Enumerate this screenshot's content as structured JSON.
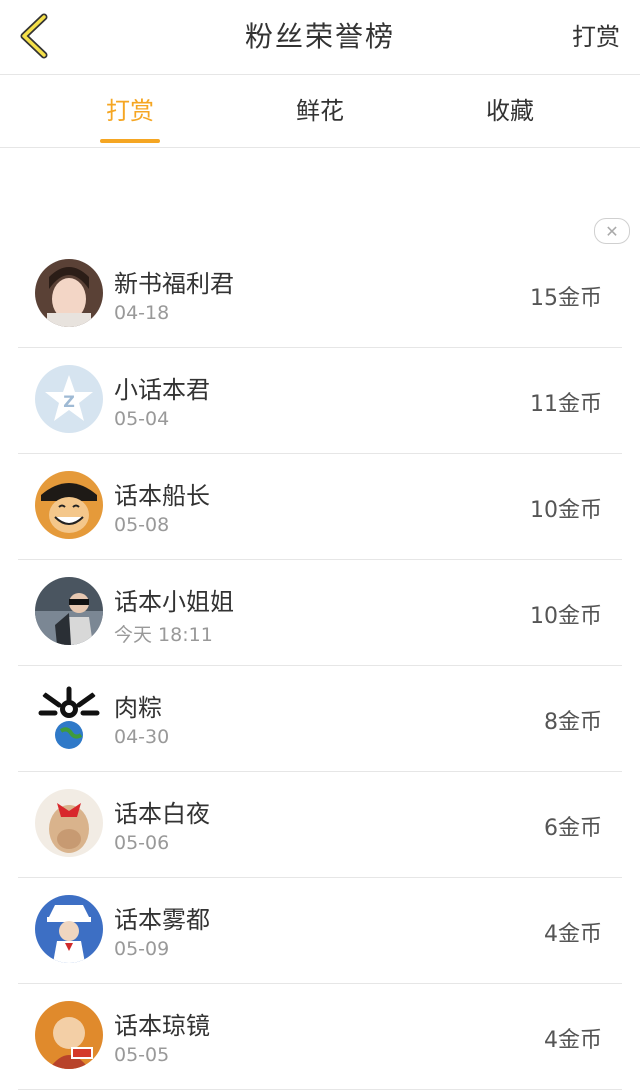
{
  "header": {
    "title": "粉丝荣誉榜",
    "action": "打赏"
  },
  "tabs": [
    {
      "label": "打赏",
      "active": true
    },
    {
      "label": "鲜花",
      "active": false
    },
    {
      "label": "收藏",
      "active": false
    }
  ],
  "accent_color": "#f5a623",
  "ranking": [
    {
      "name": "新书福利君",
      "date": "04-18",
      "amount": "15金币"
    },
    {
      "name": "小话本君",
      "date": "05-04",
      "amount": "11金币"
    },
    {
      "name": "话本船长",
      "date": "05-08",
      "amount": "10金币"
    },
    {
      "name": "话本小姐姐",
      "date": "今天 18:11",
      "amount": "10金币"
    },
    {
      "name": "肉粽",
      "date": "04-30",
      "amount": "8金币"
    },
    {
      "name": "话本白夜",
      "date": "05-06",
      "amount": "6金币"
    },
    {
      "name": "话本雾都",
      "date": "05-09",
      "amount": "4金币"
    },
    {
      "name": "话本琼镜",
      "date": "05-05",
      "amount": "4金币"
    }
  ]
}
